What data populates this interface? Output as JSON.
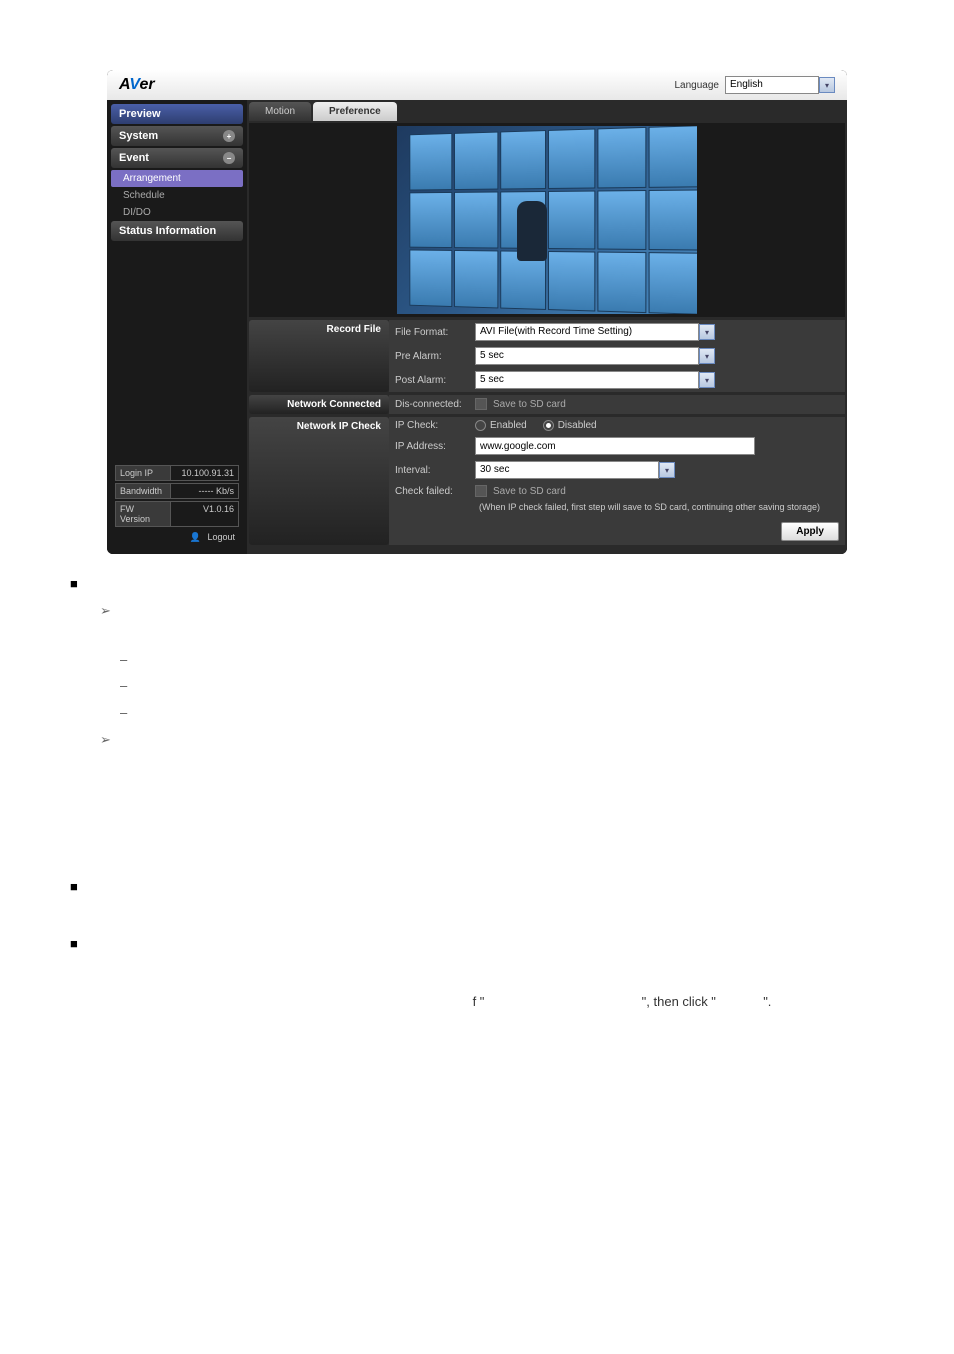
{
  "header": {
    "language_label": "Language",
    "language_value": "English"
  },
  "sidebar": {
    "nav": {
      "preview": "Preview",
      "system": "System",
      "event": "Event",
      "status": "Status Information"
    },
    "event_subs": {
      "arrangement": "Arrangement",
      "schedule": "Schedule",
      "dido": "DI/DO"
    },
    "info": {
      "login_ip_label": "Login IP",
      "login_ip_value": "10.100.91.31",
      "bandwidth_label": "Bandwidth",
      "bandwidth_value": "----- Kb/s",
      "fw_label": "FW Version",
      "fw_value": "V1.0.16"
    },
    "logout": "Logout"
  },
  "tabs": {
    "motion": "Motion",
    "preference": "Preference"
  },
  "sections": {
    "record_file": {
      "title": "Record File",
      "file_format_label": "File Format:",
      "file_format_value": "AVI File(with Record Time Setting)",
      "pre_alarm_label": "Pre Alarm:",
      "pre_alarm_value": "5 sec",
      "post_alarm_label": "Post Alarm:",
      "post_alarm_value": "5 sec"
    },
    "network_connected": {
      "title": "Network Connected",
      "disconnected_label": "Dis-connected:",
      "save_sd_label": "Save to SD card"
    },
    "network_ip_check": {
      "title": "Network IP Check",
      "ip_check_label": "IP Check:",
      "enabled_label": "Enabled",
      "disabled_label": "Disabled",
      "ip_address_label": "IP Address:",
      "ip_address_value": "www.google.com",
      "interval_label": "Interval:",
      "interval_value": "30 sec",
      "check_failed_label": "Check failed:",
      "save_sd_label": "Save to SD card",
      "hint": "(When IP check failed, first step will save to SD card, continuing other saving storage)"
    }
  },
  "apply_button": "Apply",
  "body": {
    "caption_fragment_f": "f \"",
    "caption_fragment_mid": "\", then click \"",
    "caption_fragment_end": "\"."
  }
}
